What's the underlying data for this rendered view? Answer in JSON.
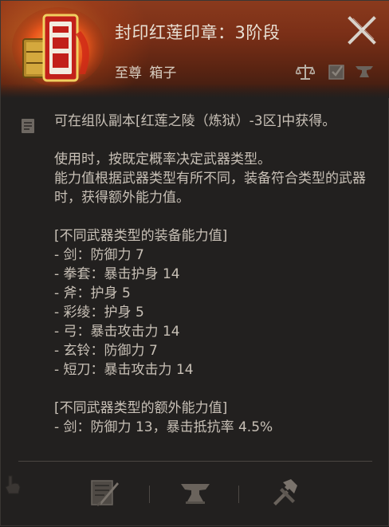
{
  "header": {
    "title": "封印红莲印章：3阶段",
    "subtitle": "至尊 箱子",
    "icons": [
      "scale-icon",
      "checkbox-icon",
      "anvil-icon"
    ]
  },
  "description": {
    "line1": "可在组队副本[红莲之陵（炼狱）-3区]中获得。",
    "para2": "使用时，按既定概率决定武器类型。",
    "para3": "能力值根据武器类型有所不同，装备符合类型的武器时，获得额外能力值。",
    "section1_title": "[不同武器类型的装备能力值]",
    "section1_items": [
      "- 剑：防御力 7",
      "- 拳套：暴击护身 14",
      "- 斧：护身 5",
      "- 彩绫：护身 5",
      "- 弓：暴击攻击力 14",
      "- 玄铃：防御力 7",
      "- 短刀：暴击攻击力 14"
    ],
    "section2_title": "[不同武器类型的额外能力值]",
    "section2_items": [
      "- 剑：防御力 13，暴击抵抗率 4.5%"
    ]
  },
  "footer": {
    "buttons": [
      "dismantle-icon",
      "anvil-icon",
      "hammer-icon"
    ]
  },
  "colors": {
    "header_bg": "#7a2f17",
    "text": "#c8c0b6",
    "title": "#e8e0d4"
  }
}
